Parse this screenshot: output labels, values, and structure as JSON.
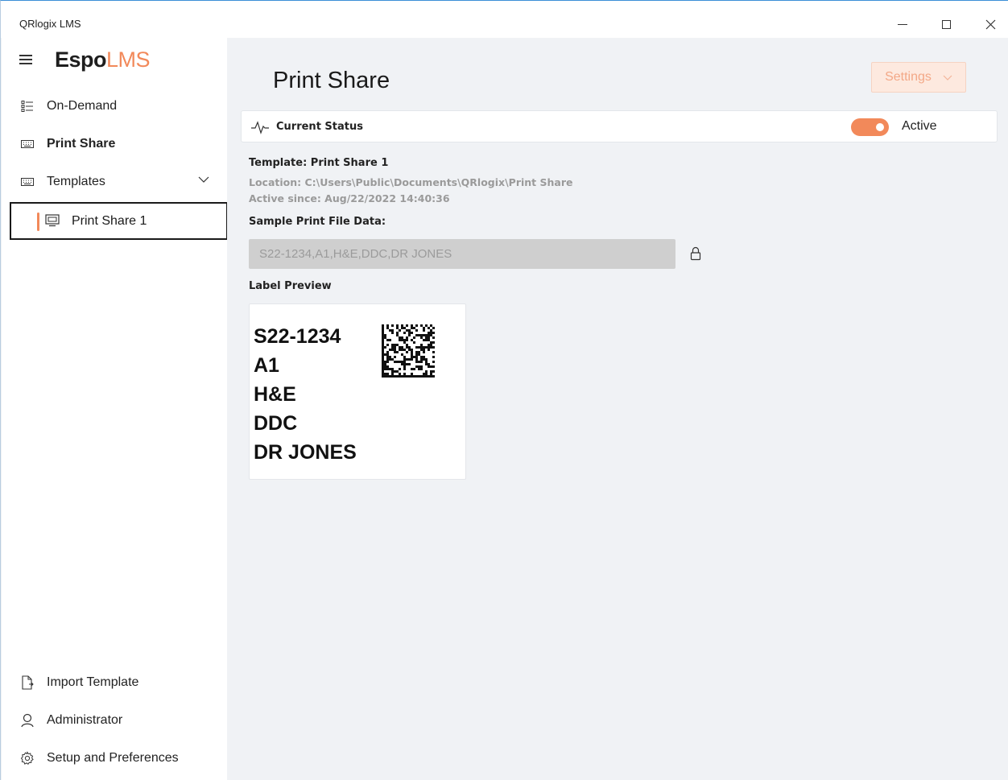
{
  "window": {
    "title": "QRlogix LMS"
  },
  "brand": {
    "main": "Espo",
    "accent": "LMS",
    "accent_color": "#f2895a"
  },
  "sidebar": {
    "items": [
      {
        "label": "On-Demand",
        "icon": "list-icon"
      },
      {
        "label": "Print Share",
        "icon": "keyboard-icon"
      },
      {
        "label": "Templates",
        "icon": "keyboard-icon"
      }
    ],
    "sub_items": [
      {
        "label": "Print Share 1",
        "icon": "monitor-icon"
      }
    ],
    "bottom_items": [
      {
        "label": "Import Template",
        "icon": "file-import-icon"
      },
      {
        "label": "Administrator",
        "icon": "user-icon"
      },
      {
        "label": "Setup and Preferences",
        "icon": "gear-icon"
      }
    ]
  },
  "main": {
    "title": "Print Share",
    "settings_label": "Settings",
    "status": {
      "label": "Current Status",
      "toggle_state": "on",
      "active_label": "Active"
    },
    "template": {
      "name": "Template: Print Share 1",
      "location": "Location: C:\\Users\\Public\\Documents\\QRlogix\\Print Share",
      "active_since": "Active since: Aug/22/2022 14:40:36"
    },
    "sample": {
      "label": "Sample Print File Data:",
      "value": "S22-1234,A1,H&E,DDC,DR JONES"
    },
    "preview": {
      "label": "Label Preview",
      "lines": [
        "S22-1234",
        "A1",
        "H&E",
        "DDC",
        "DR JONES"
      ]
    }
  }
}
